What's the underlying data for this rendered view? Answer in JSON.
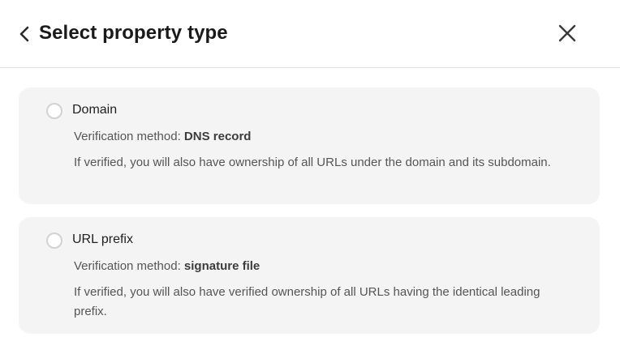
{
  "dialog": {
    "title": "Select property type",
    "back_icon": "chevron-left-icon",
    "close_icon": "close-icon"
  },
  "options": [
    {
      "label": "Domain",
      "method_label": "Verification method:",
      "method_value": "DNS record",
      "description": "If verified, you will also have ownership of all URLs under the domain and its subdomain.",
      "selected": false
    },
    {
      "label": "URL prefix",
      "method_label": "Verification method:",
      "method_value": "signature file",
      "description": "If verified, you will also have verified ownership of all URLs having the identical leading prefix.",
      "selected": false
    }
  ],
  "colors": {
    "card_background": "#f4f4f4",
    "radio_border": "#d2d2d2",
    "divider": "#e3e3e3"
  }
}
